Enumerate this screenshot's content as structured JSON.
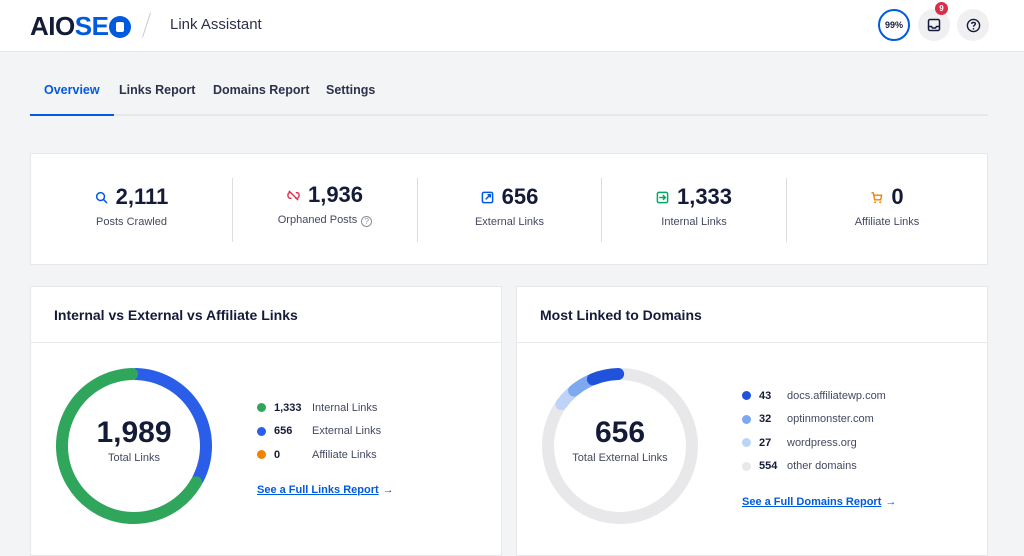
{
  "header": {
    "logo_aio": "AIO",
    "logo_seo": "SE",
    "page_title": "Link Assistant",
    "score": "99%",
    "notifications_count": "9"
  },
  "tabs": [
    {
      "label": "Overview",
      "active": true
    },
    {
      "label": "Links Report",
      "active": false
    },
    {
      "label": "Domains Report",
      "active": false
    },
    {
      "label": "Settings",
      "active": false
    }
  ],
  "stats": [
    {
      "icon": "search-icon",
      "value": "2,111",
      "label": "Posts Crawled",
      "color": "#005ae0"
    },
    {
      "icon": "unlink-icon",
      "value": "1,936",
      "label": "Orphaned Posts",
      "color": "#df2a4a",
      "help": "?"
    },
    {
      "icon": "external-link-icon",
      "value": "656",
      "label": "External Links",
      "color": "#005ae0"
    },
    {
      "icon": "internal-link-icon",
      "value": "1,333",
      "label": "Internal Links",
      "color": "#00aa63"
    },
    {
      "icon": "cart-icon",
      "value": "0",
      "label": "Affiliate Links",
      "color": "#f18200"
    }
  ],
  "links_panel": {
    "title": "Internal vs External vs Affiliate Links",
    "total": "1,989",
    "total_label": "Total Links",
    "legend": [
      {
        "value": "1,333",
        "label": "Internal Links",
        "color": "#2fa65c",
        "amount": 1333
      },
      {
        "value": "656",
        "label": "External Links",
        "color": "#2a5ee8",
        "amount": 656
      },
      {
        "value": "0",
        "label": "Affiliate Links",
        "color": "#f18200",
        "amount": 0
      }
    ],
    "link_label": "See a Full Links Report",
    "arrow": "→"
  },
  "domains_panel": {
    "title": "Most Linked to Domains",
    "total": "656",
    "total_label": "Total External Links",
    "legend": [
      {
        "value": "43",
        "label": "docs.affiliatewp.com",
        "color": "#1f53dc",
        "amount": 43
      },
      {
        "value": "32",
        "label": "optinmonster.com",
        "color": "#7ea8ef",
        "amount": 32
      },
      {
        "value": "27",
        "label": "wordpress.org",
        "color": "#bdd3f7",
        "amount": 27
      },
      {
        "value": "554",
        "label": "other domains",
        "color": "#e8e8eb",
        "amount": 554
      }
    ],
    "link_label": "See a Full Domains Report",
    "arrow": "→"
  }
}
